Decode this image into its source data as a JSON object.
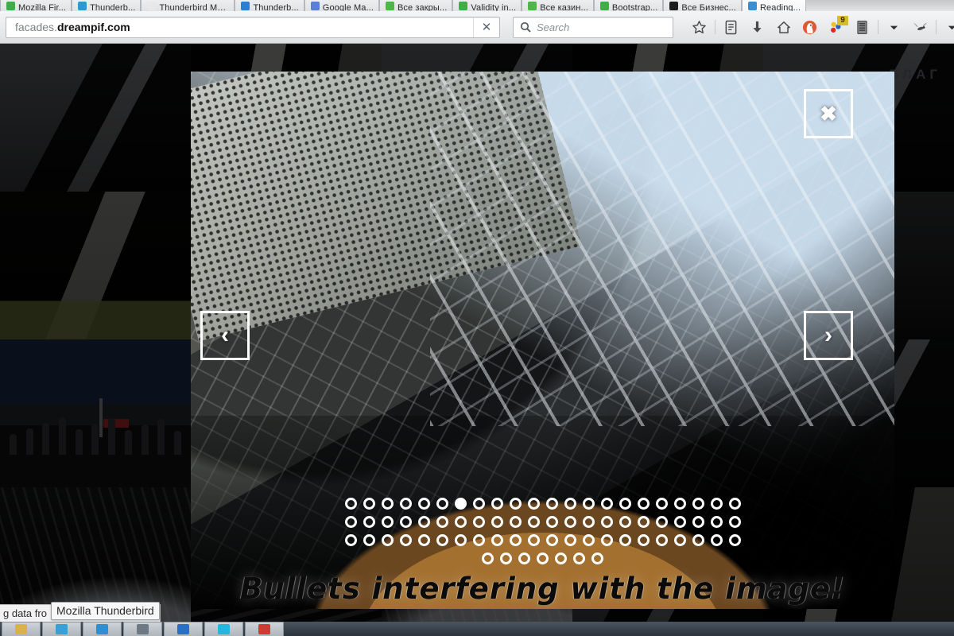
{
  "browser": {
    "tabs": [
      {
        "label": "Mozilla Fir...",
        "favicon": "#3fae49",
        "icon_name": "firefox-favicon",
        "selected": false
      },
      {
        "label": "Thunderb...",
        "favicon": "#2a9ad6",
        "icon_name": "thunderbird-favicon",
        "selected": false
      },
      {
        "label": "Thunderbird Ma...",
        "favicon": "#e8e8e8",
        "icon_name": "page-favicon",
        "selected": false
      },
      {
        "label": "Thunderb...",
        "favicon": "#2f7fd0",
        "icon_name": "mail-favicon",
        "selected": false
      },
      {
        "label": "Google Ma...",
        "favicon": "#5b7fd4",
        "icon_name": "google-favicon",
        "selected": false
      },
      {
        "label": "Все закры...",
        "favicon": "#4cb648",
        "icon_name": "green-favicon",
        "selected": false
      },
      {
        "label": "Validity in...",
        "favicon": "#3fae49",
        "icon_name": "validity-favicon",
        "selected": false
      },
      {
        "label": "Все казин...",
        "favicon": "#4cb648",
        "icon_name": "green-favicon",
        "selected": false
      },
      {
        "label": "Bootstrap...",
        "favicon": "#3fae49",
        "icon_name": "bootstrap-favicon",
        "selected": false
      },
      {
        "label": "Все Бизнес...",
        "favicon": "#1b1b1b",
        "icon_name": "dark-favicon",
        "selected": false
      },
      {
        "label": "Reading...",
        "favicon": "#3b8fd0",
        "icon_name": "reading-favicon",
        "selected": true
      }
    ],
    "url": {
      "prefix": "facades.",
      "domain": "dreampif.com"
    },
    "stop_label": "✕",
    "search": {
      "placeholder": "Search",
      "icon_name": "search-icon"
    },
    "toolbar_icons": [
      {
        "name": "bookmark-star-icon",
        "glyph": "☆",
        "color": "#4a4a4a",
        "badge": ""
      },
      {
        "name": "reader-list-icon",
        "glyph": "὜D",
        "color": "#4a4a4a",
        "badge": ""
      },
      {
        "name": "download-arrow-icon",
        "glyph": "↓",
        "color": "#4a4a4a",
        "badge": ""
      },
      {
        "name": "home-icon",
        "glyph": "⌂",
        "color": "#4a4a4a",
        "badge": ""
      },
      {
        "name": "duckduckgo-icon",
        "glyph": "",
        "color": "#de5833",
        "badge": ""
      },
      {
        "name": "extension-balloons-icon",
        "glyph": "",
        "color": "#d8bb2a",
        "badge": "9"
      },
      {
        "name": "clipboard-manager-icon",
        "glyph": "",
        "color": "#6b6b6b",
        "badge": ""
      },
      {
        "name": "overflow-chevron-icon",
        "glyph": "▾",
        "color": "#3a3a3a",
        "badge": ""
      },
      {
        "name": "mosquito-icon",
        "glyph": "",
        "color": "#555",
        "badge": ""
      },
      {
        "name": "menu-chevron-icon",
        "glyph": "▾",
        "color": "#3a3a3a",
        "badge": ""
      }
    ]
  },
  "page": {
    "heading": "БЛАГ",
    "gallery_cells": [
      "g-glass",
      "g-dark",
      "g-glass",
      "g-dark",
      "g-glass",
      "g-grass",
      "g-dark",
      "g-grass",
      "g-sky",
      "g-flower",
      "g-crowd",
      "g-crowd",
      "g-ceil",
      "g-stairs",
      "g-glass",
      "g-ceil",
      "g-stairs",
      "g-ceil",
      "g-glass",
      "g-dark"
    ]
  },
  "lightbox": {
    "close_label": "✖",
    "prev_label": "‹",
    "next_label": "›",
    "caption": "Bullets interfering with the image!",
    "bullets": {
      "total": 73,
      "active_index": 6,
      "rows": [
        22,
        22,
        22,
        7
      ]
    }
  },
  "status": {
    "text": "g data fro",
    "text_tail": "m...",
    "tooltip": "Mozilla Thunderbird"
  },
  "taskbar": {
    "items": [
      {
        "name": "taskbar-item-folder",
        "color": "#d8b24a"
      },
      {
        "name": "taskbar-item-firefox",
        "color": "#3a9fd6"
      },
      {
        "name": "taskbar-item-browser",
        "color": "#2f8fd0"
      },
      {
        "name": "taskbar-item-editor",
        "color": "#6d7a86"
      },
      {
        "name": "taskbar-item-thunderbird",
        "color": "#2a6fc4"
      },
      {
        "name": "taskbar-item-terminal",
        "color": "#24b5e0"
      },
      {
        "name": "taskbar-item-pdf",
        "color": "#cf3a36"
      }
    ]
  },
  "colors": {
    "accent": "#ffffff",
    "chrome_bg": "#e9eaec",
    "badge": "#d8bb2a"
  }
}
